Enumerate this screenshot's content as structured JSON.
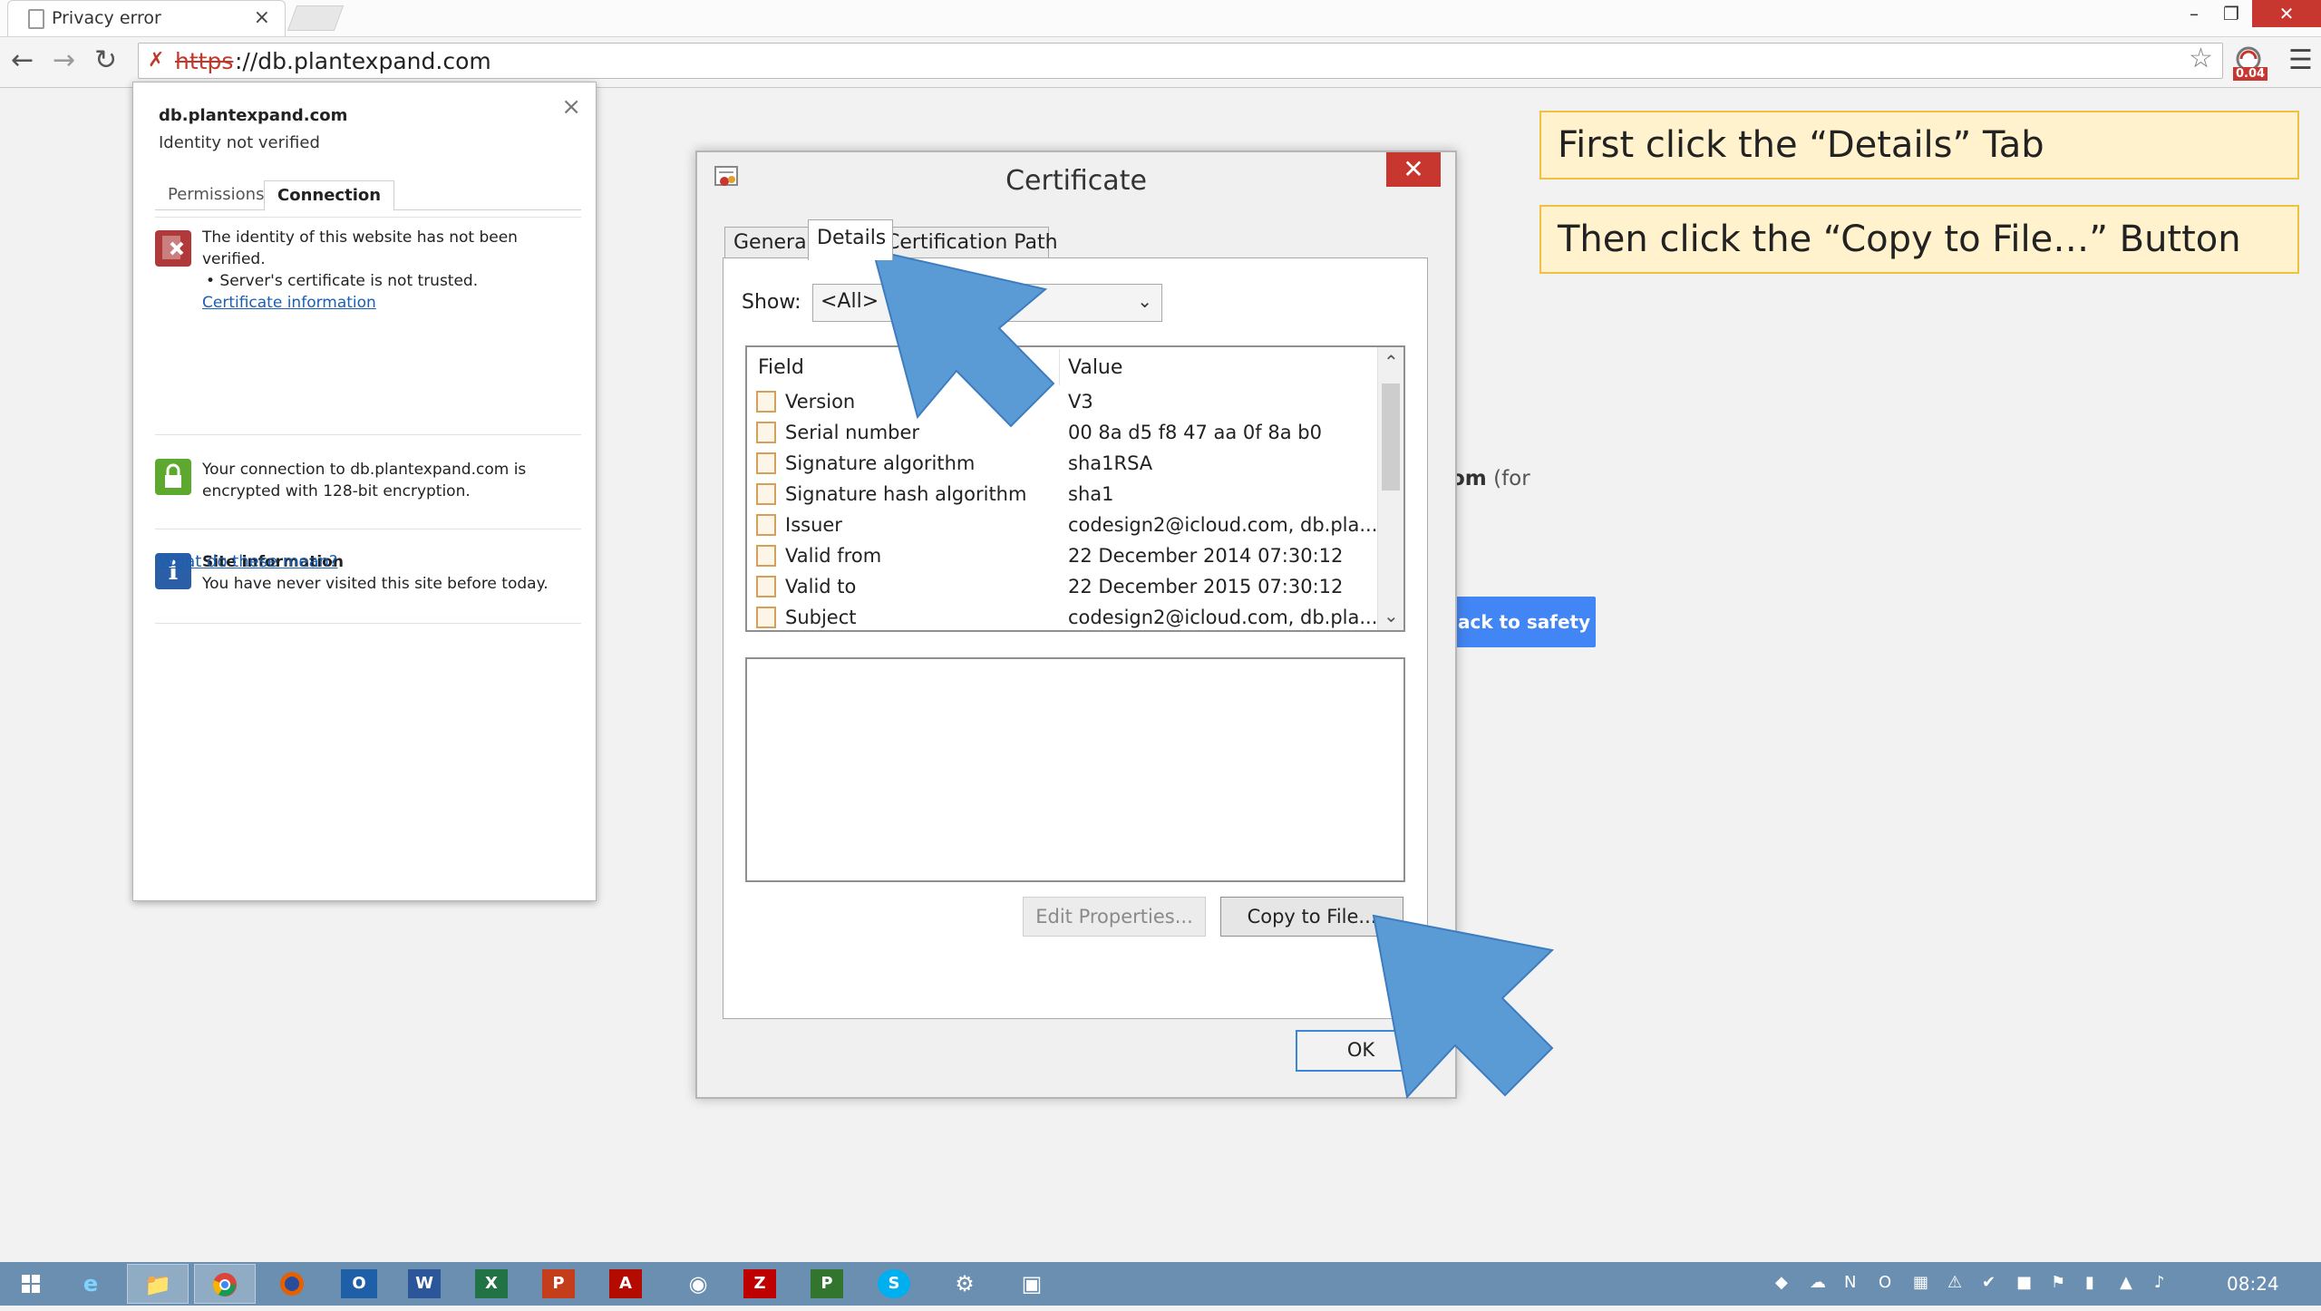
{
  "browser": {
    "tab_title": "Privacy error",
    "tab_close": "×",
    "window_controls": {
      "minimize": "–",
      "restore": "❐",
      "close": "✕"
    },
    "url_scheme": "https",
    "url_rest": "://db.plantexpand.com",
    "extension_badge": "0.04"
  },
  "popup": {
    "host": "db.plantexpand.com",
    "identity": "Identity not verified",
    "tabs": [
      "Permissions",
      "Connection"
    ],
    "identity_line1": "The identity of this website has not been verified.",
    "identity_line2": "• Server's certificate is not trusted.",
    "cert_link": "Certificate information",
    "connection_text": "Your connection to db.plantexpand.com is encrypted with 128-bit encryption.",
    "site_info_title": "Site information",
    "site_info_text": "You have never visited this site before today.",
    "what_link": "What do these mean?"
  },
  "background_page": {
    "partial_text_bold": "om",
    "partial_text": " (for",
    "safety_button": "ack to safety"
  },
  "dialog": {
    "title": "Certificate",
    "close": "✕",
    "tabs": {
      "general": "General",
      "details": "Details",
      "path": "Certification Path"
    },
    "show_label": "Show:",
    "show_value": "<All>",
    "col_field": "Field",
    "col_value": "Value",
    "rows": [
      {
        "field": "Version",
        "value": "V3"
      },
      {
        "field": "Serial number",
        "value": "00 8a d5 f8 47 aa 0f 8a b0"
      },
      {
        "field": "Signature algorithm",
        "value": "sha1RSA"
      },
      {
        "field": "Signature hash algorithm",
        "value": "sha1"
      },
      {
        "field": "Issuer",
        "value": "codesign2@icloud.com, db.pla..."
      },
      {
        "field": "Valid from",
        "value": "22 December 2014 07:30:12"
      },
      {
        "field": "Valid to",
        "value": "22 December 2015 07:30:12"
      },
      {
        "field": "Subject",
        "value": "codesign2@icloud.com, db.pla..."
      }
    ],
    "edit_button": "Edit Properties...",
    "copy_button": "Copy to File...",
    "ok_button": "OK"
  },
  "callouts": {
    "first": "First click the “Details” Tab",
    "second": "Then click the “Copy to File…” Button"
  },
  "taskbar": {
    "apps": [
      "windows-start",
      "internet-explorer",
      "file-explorer",
      "chrome",
      "firefox",
      "outlook",
      "word",
      "excel",
      "powerpoint",
      "acrobat",
      "gimp",
      "filezilla",
      "project",
      "skype",
      "network-tool",
      "terminal"
    ],
    "clock": "08:24"
  },
  "colors": {
    "accent_blue": "#5b9bd5",
    "callout_fill": "#fff2cc",
    "callout_border": "#f0c040",
    "close_red": "#c7372f",
    "taskbar": "#6b8fb0"
  }
}
